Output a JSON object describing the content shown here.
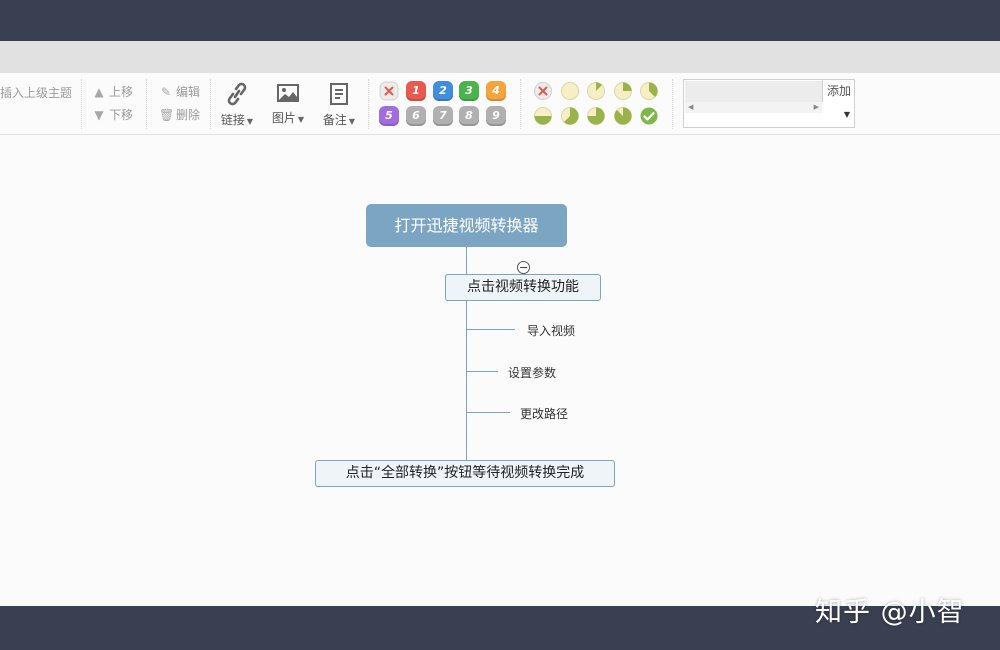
{
  "toolbar": {
    "insert_parent": "插入上级主题",
    "move_up": "上移",
    "move_down": "下移",
    "edit": "编辑",
    "delete": "删除",
    "link": "链接",
    "image": "图片",
    "note": "备注",
    "priority_labels": [
      "1",
      "2",
      "3",
      "4",
      "5",
      "6",
      "7",
      "8",
      "9"
    ],
    "add_button": "添加"
  },
  "colors": {
    "dark_bar": "#3a3f51",
    "node_accent": "#7ba5c2",
    "priority": [
      "#e8594f",
      "#3f8fdc",
      "#4bb34b",
      "#f4a43a",
      "#a16ce0",
      "#b0b0b0",
      "#b0b0b0",
      "#b0b0b0",
      "#b0b0b0"
    ]
  },
  "mindmap": {
    "root": "打开迅捷视频转换器",
    "main_topic_1": "点击视频转换功能",
    "sub_topics": [
      "导入视频",
      "设置参数",
      "更改路径"
    ],
    "main_topic_2": "点击“全部转换”按钮等待视频转换完成"
  },
  "watermark": "知乎 @小智"
}
